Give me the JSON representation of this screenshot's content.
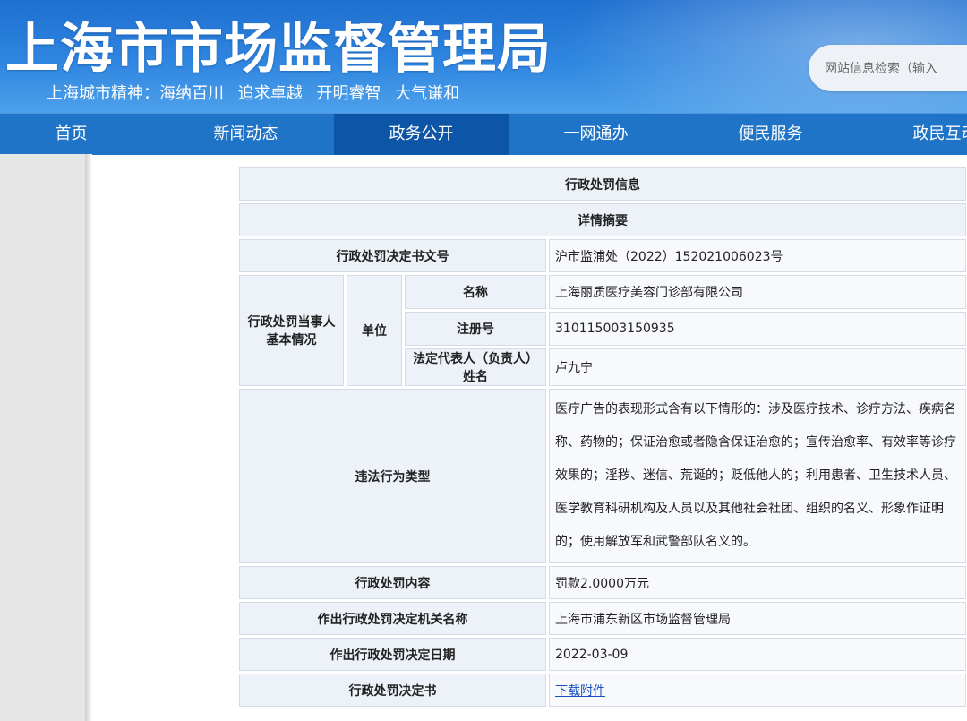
{
  "header": {
    "site_title": "上海市市场监督管理局",
    "motto": "上海城市精神：海纳百川  追求卓越  开明睿智  大气谦和",
    "search_placeholder": "网站信息检索（输入"
  },
  "nav": {
    "items": [
      {
        "label": "首页",
        "active": false
      },
      {
        "label": "新闻动态",
        "active": false
      },
      {
        "label": "政务公开",
        "active": true
      },
      {
        "label": "一网通办",
        "active": false
      },
      {
        "label": "便民服务",
        "active": false
      },
      {
        "label": "政民互动",
        "active": false
      }
    ]
  },
  "detail": {
    "section_title": "行政处罚信息",
    "subsection_title": "详情摘要",
    "decision_no_label": "行政处罚决定书文号",
    "decision_no_value": "沪市监浦处（2022）152021006023号",
    "party_label": "行政处罚当事人基本情况",
    "unit_label": "单位",
    "name_label": "名称",
    "name_value": "上海丽质医疗美容门诊部有限公司",
    "reg_no_label": "注册号",
    "reg_no_value": "310115003150935",
    "legal_rep_label": "法定代表人（负责人）姓名",
    "legal_rep_value": "卢九宁",
    "violation_label": "违法行为类型",
    "violation_value": "医疗广告的表现形式含有以下情形的：涉及医疗技术、诊疗方法、疾病名称、药物的；保证治愈或者隐含保证治愈的；宣传治愈率、有效率等诊疗效果的；淫秽、迷信、荒诞的；贬低他人的；利用患者、卫生技术人员、医学教育科研机构及人员以及其他社会社团、组织的名义、形象作证明的；使用解放军和武警部队名义的。",
    "penalty_label": "行政处罚内容",
    "penalty_value": "罚款2.0000万元",
    "authority_label": "作出行政处罚决定机关名称",
    "authority_value": "上海市浦东新区市场监督管理局",
    "date_label": "作出行政处罚决定日期",
    "date_value": "2022-03-09",
    "document_label": "行政处罚决定书",
    "document_link": "下载附件"
  },
  "colors": {
    "header_blue": "#2f86e0",
    "nav_blue": "#1f74c8",
    "nav_active": "#0d55a6",
    "cell_bg": "#f4f7fb",
    "link": "#1a4fc0"
  }
}
